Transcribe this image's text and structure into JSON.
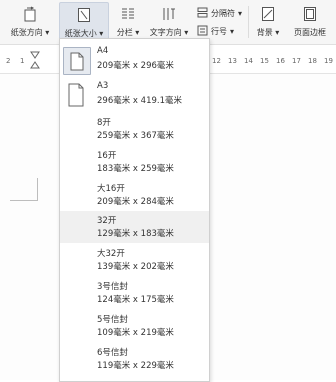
{
  "ribbon": {
    "orientation_label": "纸张方向",
    "size_label": "纸张大小",
    "columns_label": "分栏",
    "text_direction_label": "文字方向",
    "break_label": "分隔符",
    "line_number_label": "行号",
    "background_label": "背景",
    "page_border_label": "页面边框"
  },
  "ruler": {
    "left_numbers": [
      "2",
      "1"
    ],
    "right_numbers": [
      "12",
      "13",
      "14",
      "15",
      "16",
      "17",
      "18",
      "19"
    ]
  },
  "paper_sizes": [
    {
      "name": "A4",
      "dims": "209毫米 x 296毫米"
    },
    {
      "name": "A3",
      "dims": "296毫米 x 419.1毫米"
    },
    {
      "name": "8开",
      "dims": "259毫米 x 367毫米"
    },
    {
      "name": "16开",
      "dims": "183毫米 x 259毫米"
    },
    {
      "name": "大16开",
      "dims": "209毫米 x 284毫米"
    },
    {
      "name": "32开",
      "dims": "129毫米 x 183毫米"
    },
    {
      "name": "大32开",
      "dims": "139毫米 x 202毫米"
    },
    {
      "name": "3号信封",
      "dims": "124毫米 x 175毫米"
    },
    {
      "name": "5号信封",
      "dims": "109毫米 x 219毫米"
    },
    {
      "name": "6号信封",
      "dims": "119毫米 x 229毫米"
    }
  ]
}
